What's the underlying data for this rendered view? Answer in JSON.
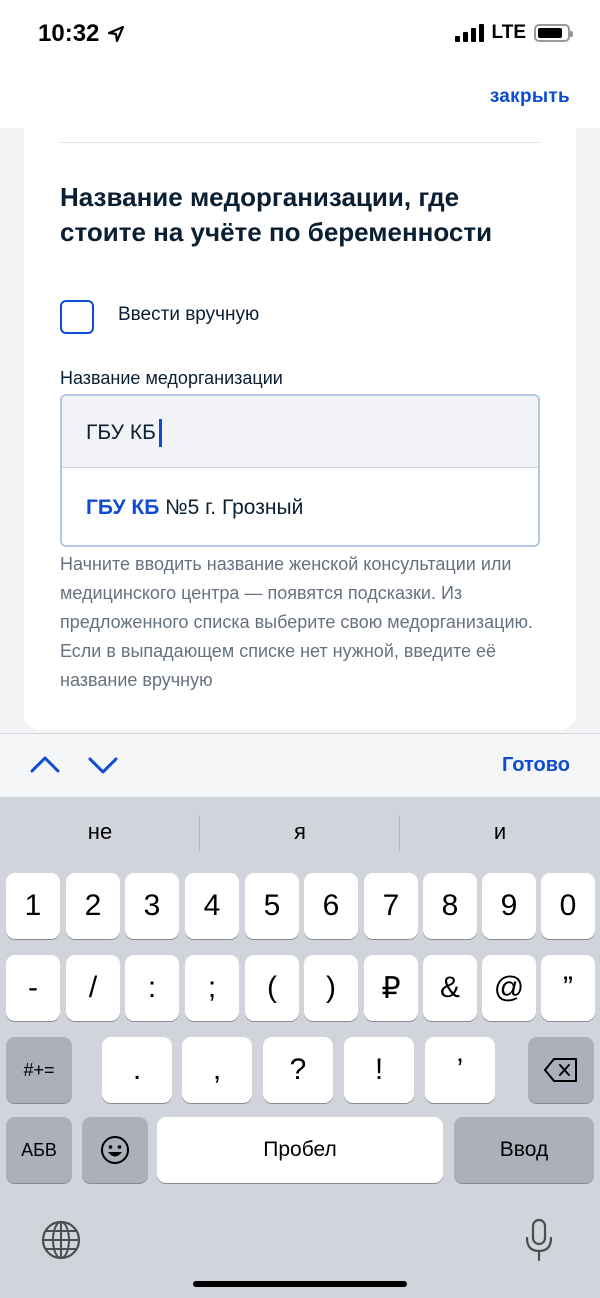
{
  "status_bar": {
    "time": "10:32",
    "network": "LTE"
  },
  "header": {
    "close_label": "закрыть"
  },
  "form": {
    "title": "Название медорганизации, где стоите на учёте по беременности",
    "manual_checkbox_label": "Ввести вручную",
    "manual_checked": false,
    "field_label": "Название медорганизации",
    "field_value": "ГБУ КБ",
    "suggestion_match": "ГБУ КБ",
    "suggestion_rest": " №5 г. Грозный",
    "hint": "Начните вводить название женской консультации или медицинского центра — появятся подсказки. Из предложенного списка выберите свою медорганизацию. Если в выпадающем списке нет нужной, введите её название вручную"
  },
  "accessory": {
    "done_label": "Готово"
  },
  "keyboard": {
    "predictions": [
      "не",
      "я",
      "и"
    ],
    "row1": [
      "1",
      "2",
      "3",
      "4",
      "5",
      "6",
      "7",
      "8",
      "9",
      "0"
    ],
    "row2": [
      "-",
      "/",
      ":",
      ";",
      "(",
      ")",
      "₽",
      "&",
      "@",
      "”"
    ],
    "row3_left": "#+=",
    "row3": [
      ".",
      ",",
      "?",
      "!",
      "’"
    ],
    "abc_label": "АБВ",
    "space_label": "Пробел",
    "return_label": "Ввод"
  },
  "colors": {
    "accent": "#0d4cd3",
    "text": "#0b1f33",
    "hint_text": "#66727f",
    "keyboard_bg": "#d1d4da"
  }
}
